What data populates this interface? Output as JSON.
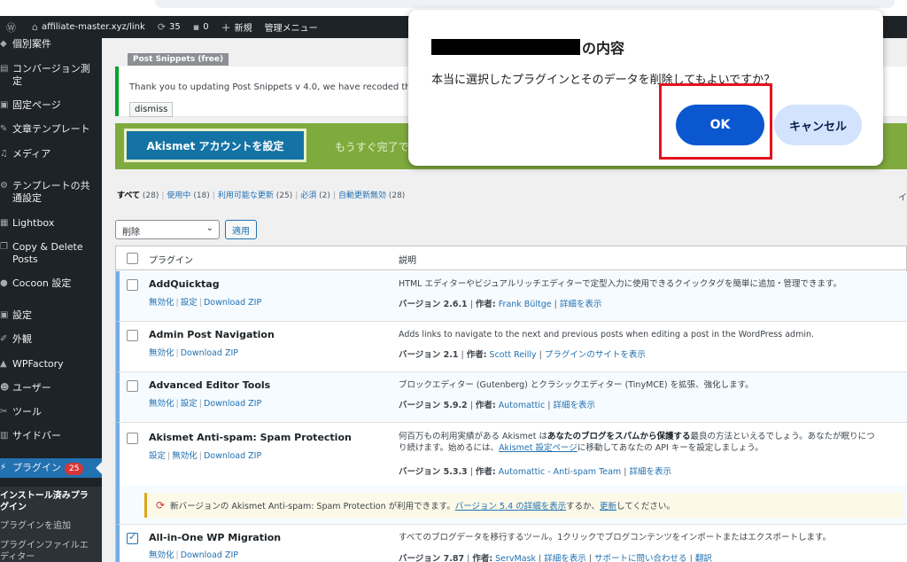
{
  "admin_bar": {
    "site_url": "affiliate-master.xyz/link",
    "updates_count": "35",
    "comments_count": "0",
    "new_label": "新規",
    "admin_menu_label": "管理メニュー"
  },
  "sidebar": {
    "items": [
      {
        "label": "個別案件",
        "icon": "pin-icon"
      },
      {
        "label": "コンバージョン測定",
        "icon": "chart-icon"
      },
      {
        "label": "固定ページ",
        "icon": "page-icon"
      },
      {
        "label": "文章テンプレート",
        "icon": "template-icon"
      },
      {
        "label": "メディア",
        "icon": "media-icon"
      },
      {
        "label": "テンプレートの共通設定",
        "icon": "gear-icon"
      },
      {
        "label": "Lightbox",
        "icon": "lightbox-icon"
      },
      {
        "label": "Copy & Delete Posts",
        "icon": "copy-icon"
      },
      {
        "label": "Cocoon 設定",
        "icon": "cocoon-icon"
      },
      {
        "label": "設定",
        "icon": "settings-icon"
      },
      {
        "label": "外観",
        "icon": "brush-icon"
      },
      {
        "label": "WPFactory",
        "icon": "factory-icon"
      },
      {
        "label": "ユーザー",
        "icon": "user-icon"
      },
      {
        "label": "ツール",
        "icon": "wrench-icon"
      },
      {
        "label": "サイドバー",
        "icon": "sidebar-icon"
      }
    ],
    "plugins_label": "プラグイン",
    "plugins_badge": "25",
    "submenu": [
      "インストール済みプラグイン",
      "プラグインを追加",
      "プラグインファイルエディター"
    ]
  },
  "notice": {
    "tag": "Post Snippets (free)",
    "text": "Thank you to updating Post Snippets v 4.0, we have recoded the enti",
    "dismiss": "dismiss"
  },
  "akismet": {
    "button": "Akismet アカウントを設定",
    "text": "もうすぐ完了で"
  },
  "filters": {
    "all": "すべて",
    "all_count": "(28)",
    "active": "使用中",
    "active_count": "(18)",
    "updates": "利用可能な更新",
    "updates_count": "(25)",
    "required": "必須",
    "required_count": "(2)",
    "autoupdate_off": "自動更新無効",
    "autoupdate_off_count": "(28)",
    "right_edge": "イ"
  },
  "bulk": {
    "selected": "削除",
    "apply": "適用"
  },
  "table": {
    "col_plugin": "プラグイン",
    "col_desc": "説明",
    "plugins": [
      {
        "name": "AddQuicktag",
        "actions": [
          "無効化",
          "設定",
          "Download ZIP"
        ],
        "desc": "HTML エディターやビジュアルリッチエディターで定型入力に使用できるクイックタグを簡単に追加・管理できます。",
        "version_label": "バージョン 2.6.1",
        "author_label": "作者:",
        "author": "Frank Bültge",
        "details": "詳細を表示"
      },
      {
        "name": "Admin Post Navigation",
        "actions": [
          "無効化",
          "Download ZIP"
        ],
        "desc": "Adds links to navigate to the next and previous posts when editing a post in the WordPress admin.",
        "version_label": "バージョン 2.1",
        "author_label": "作者:",
        "author": "Scott Reilly",
        "details": "プラグインのサイトを表示"
      },
      {
        "name": "Advanced Editor Tools",
        "actions": [
          "無効化",
          "設定",
          "Download ZIP"
        ],
        "desc": "ブロックエディター (Gutenberg) とクラシックエディター (TinyMCE) を拡張、強化します。",
        "version_label": "バージョン 5.9.2",
        "author_label": "作者:",
        "author": "Automattic",
        "details": "詳細を表示"
      },
      {
        "name": "Akismet Anti-spam: Spam Protection",
        "actions": [
          "設定",
          "無効化",
          "Download ZIP"
        ],
        "desc_1a": "何百万もの利用実績がある Akismet は",
        "desc_1b": "あなたのブログをスパムから保護する",
        "desc_1c": "最良の方法といえるでしょう。あなたが眠りにつ",
        "desc_2a": "り続けます。始めるには、",
        "desc_2b": "Akismet 設定ページ",
        "desc_2c": "に移動してあなたの API キーを設定しましょう。",
        "version_label": "バージョン 5.3.3",
        "author_label": "作者:",
        "author": "Automattic - Anti-spam Team",
        "details": "詳細を表示"
      },
      {
        "name": "All-in-One WP Migration",
        "actions": [
          "無効化",
          "Download ZIP"
        ],
        "desc": "すべてのブログデータを移行するツール。1クリックでブログコンテンツをインポートまたはエクスポートします。",
        "version_label": "バージョン 7.87",
        "author_label": "作者:",
        "author": "ServMask",
        "details": "詳細を表示",
        "support": "サポートに問い合わせる",
        "translate": "翻訳"
      }
    ],
    "update_notice": {
      "prefix": "新バージョンの Akismet Anti-spam: Spam Protection が利用できます。",
      "link1": "バージョン 5.4 の詳細を表示",
      "middle": "するか、",
      "link2": "更新",
      "suffix": "してください。"
    }
  },
  "dialog": {
    "title_suffix": "の内容",
    "message": "本当に選択したプラグインとそのデータを削除してもよいですか？",
    "ok": "OK",
    "cancel": "キャンセル"
  }
}
